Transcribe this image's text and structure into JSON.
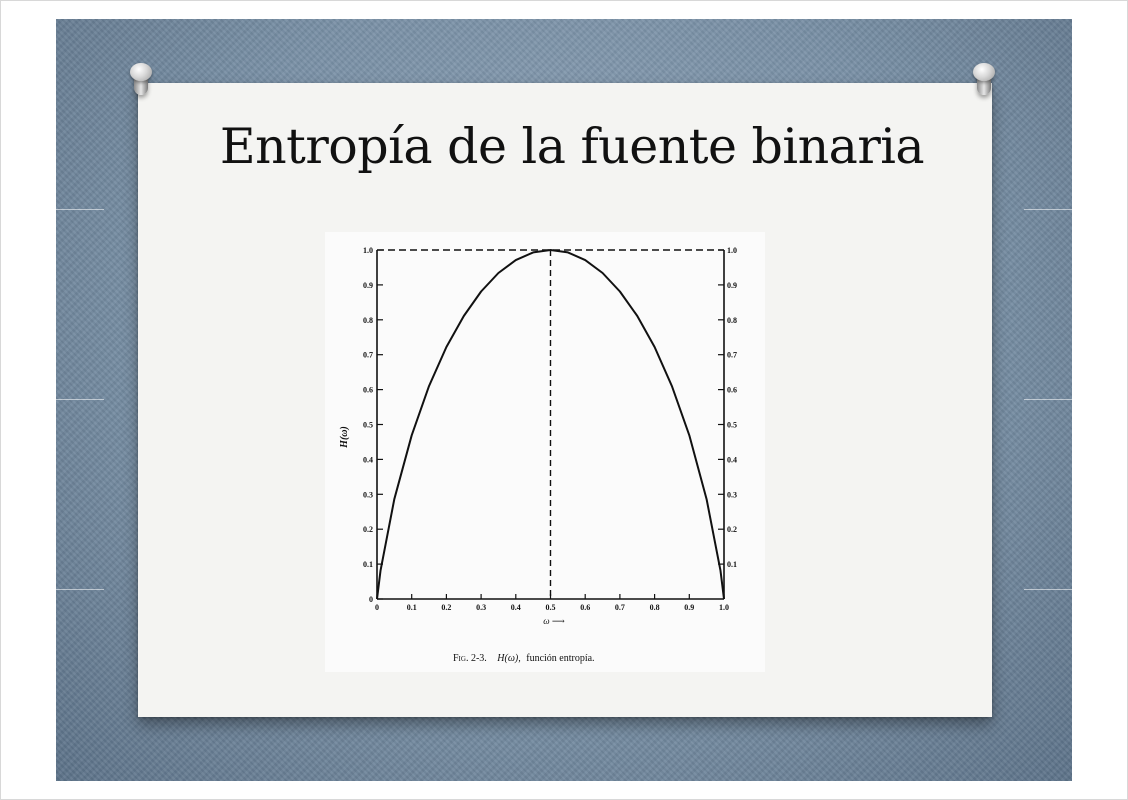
{
  "slide": {
    "title": "Entropía de la fuente binaria"
  },
  "chart_data": {
    "type": "line",
    "function": "H(w) = -w*log2(w) - (1-w)*log2(1-w)",
    "series": [
      {
        "x": [
          0,
          0.01,
          0.05,
          0.1,
          0.15,
          0.2,
          0.25,
          0.3,
          0.35,
          0.4,
          0.45,
          0.5,
          0.55,
          0.6,
          0.65,
          0.7,
          0.75,
          0.8,
          0.85,
          0.9,
          0.95,
          0.99,
          1.0
        ],
        "y": [
          0,
          0.081,
          0.286,
          0.469,
          0.61,
          0.722,
          0.811,
          0.881,
          0.934,
          0.971,
          0.993,
          1.0,
          0.993,
          0.971,
          0.934,
          0.881,
          0.811,
          0.722,
          0.61,
          0.469,
          0.286,
          0.081,
          0
        ]
      }
    ],
    "xlim": [
      0,
      1.0
    ],
    "ylim": [
      0,
      1.0
    ],
    "x_ticks": [
      "0",
      "0.1",
      "0.2",
      "0.3",
      "0.4",
      "0.5",
      "0.6",
      "0.7",
      "0.8",
      "0.9",
      "1.0"
    ],
    "y_ticks": [
      "0",
      "0.1",
      "0.2",
      "0.3",
      "0.4",
      "0.5",
      "0.6",
      "0.7",
      "0.8",
      "0.9",
      "1.0"
    ],
    "y_ticks_right": [
      "0.1",
      "0.2",
      "0.3",
      "0.4",
      "0.5",
      "0.6",
      "0.7",
      "0.8",
      "0.9",
      "1.0"
    ],
    "xlabel": "ω ⟶",
    "ylabel": "H(ω)",
    "reference_lines": [
      {
        "orientation": "vertical",
        "x": 0.5,
        "style": "dashed"
      },
      {
        "orientation": "horizontal",
        "y": 1.0,
        "style": "dashed"
      }
    ],
    "caption": {
      "fig": "Fig. 2-3.",
      "symbol": "H(ω),",
      "text": "función entropía."
    }
  }
}
